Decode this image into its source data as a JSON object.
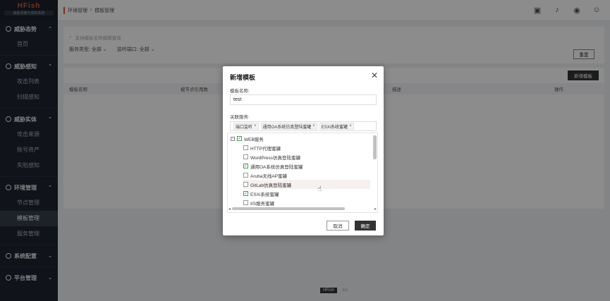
{
  "brand": {
    "name": "HFish",
    "subtitle": "威胁诱捕与感知系统"
  },
  "sidebar": {
    "groups": [
      {
        "title": "威胁态势",
        "items": [
          "首页"
        ]
      },
      {
        "title": "威胁感知",
        "items": [
          "攻击列表",
          "扫描感知"
        ]
      },
      {
        "title": "威胁实体",
        "items": [
          "攻击来源",
          "账号资产",
          "失陷感知"
        ]
      },
      {
        "title": "环境管理",
        "items": [
          "节点管理",
          "模板管理",
          "服务管理"
        ]
      },
      {
        "title": "系统配置",
        "items": []
      },
      {
        "title": "平台管理",
        "items": []
      }
    ],
    "active_item": "模板管理"
  },
  "breadcrumb": {
    "parent": "环境管理",
    "sep": ">",
    "current": "模板管理"
  },
  "filters": {
    "search_placeholder": "支持模板名称模糊查询",
    "service_type_label": "服务类型:",
    "service_type_value": "全部",
    "port_label": "监听端口:",
    "port_value": "全部",
    "reset_label": "重置"
  },
  "table": {
    "new_button": "新增模板",
    "columns": [
      "模板名称",
      "被节点引用数",
      "描述",
      "操作"
    ]
  },
  "footer": {
    "badge": "HFish",
    "text": "Co"
  },
  "modal": {
    "title": "新增模板",
    "name_label": "模板名称:",
    "name_value": "test",
    "services_label": "关联服务:",
    "tags": [
      "端口监听",
      "通用OA系统仿真登陆蜜罐",
      "ESXi系统蜜罐"
    ],
    "tree": {
      "root": "WEB服务",
      "items": [
        {
          "label": "HTTP代理蜜罐",
          "checked": false
        },
        {
          "label": "WordPress仿真登陆蜜罐",
          "checked": false
        },
        {
          "label": "通用OA系统仿真登陆蜜罐",
          "checked": true
        },
        {
          "label": "Aruba无线AP蜜罐",
          "checked": false
        },
        {
          "label": "GitLab仿真登陆蜜罐",
          "checked": false
        },
        {
          "label": "ESXi系统蜜罐",
          "checked": true
        },
        {
          "label": "IIS服务蜜罐",
          "checked": false
        }
      ]
    },
    "cancel_label": "取消",
    "ok_label": "确定"
  },
  "colors": {
    "sidebar_bg": "#1f2430",
    "brand_orange": "#e2582c",
    "primary_btn": "#333333",
    "check_green": "#2d8a3e"
  }
}
